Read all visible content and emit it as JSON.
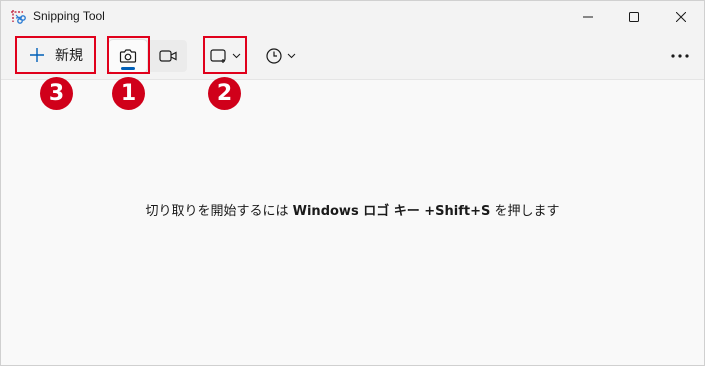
{
  "window": {
    "title": "Snipping Tool"
  },
  "toolbar": {
    "new_label": "新規",
    "modes": [
      {
        "name": "screenshot",
        "icon": "camera-icon",
        "selected": true
      },
      {
        "name": "video",
        "icon": "video-camera-icon",
        "selected": false
      }
    ],
    "snip_shape_icon": "rectangle-snip-icon",
    "delay_icon": "clock-icon",
    "more_icon": "more-dots-icon"
  },
  "main": {
    "hint_before": "切り取りを開始するには",
    "hint_keys": "Windows ロゴ キー +Shift+S",
    "hint_after": "を押します"
  },
  "annotations": {
    "badge_1": "1",
    "badge_2": "2",
    "badge_3": "3"
  },
  "colors": {
    "accent": "#005fb8",
    "highlight": "#e0001b",
    "background": "#f9f9f9"
  }
}
